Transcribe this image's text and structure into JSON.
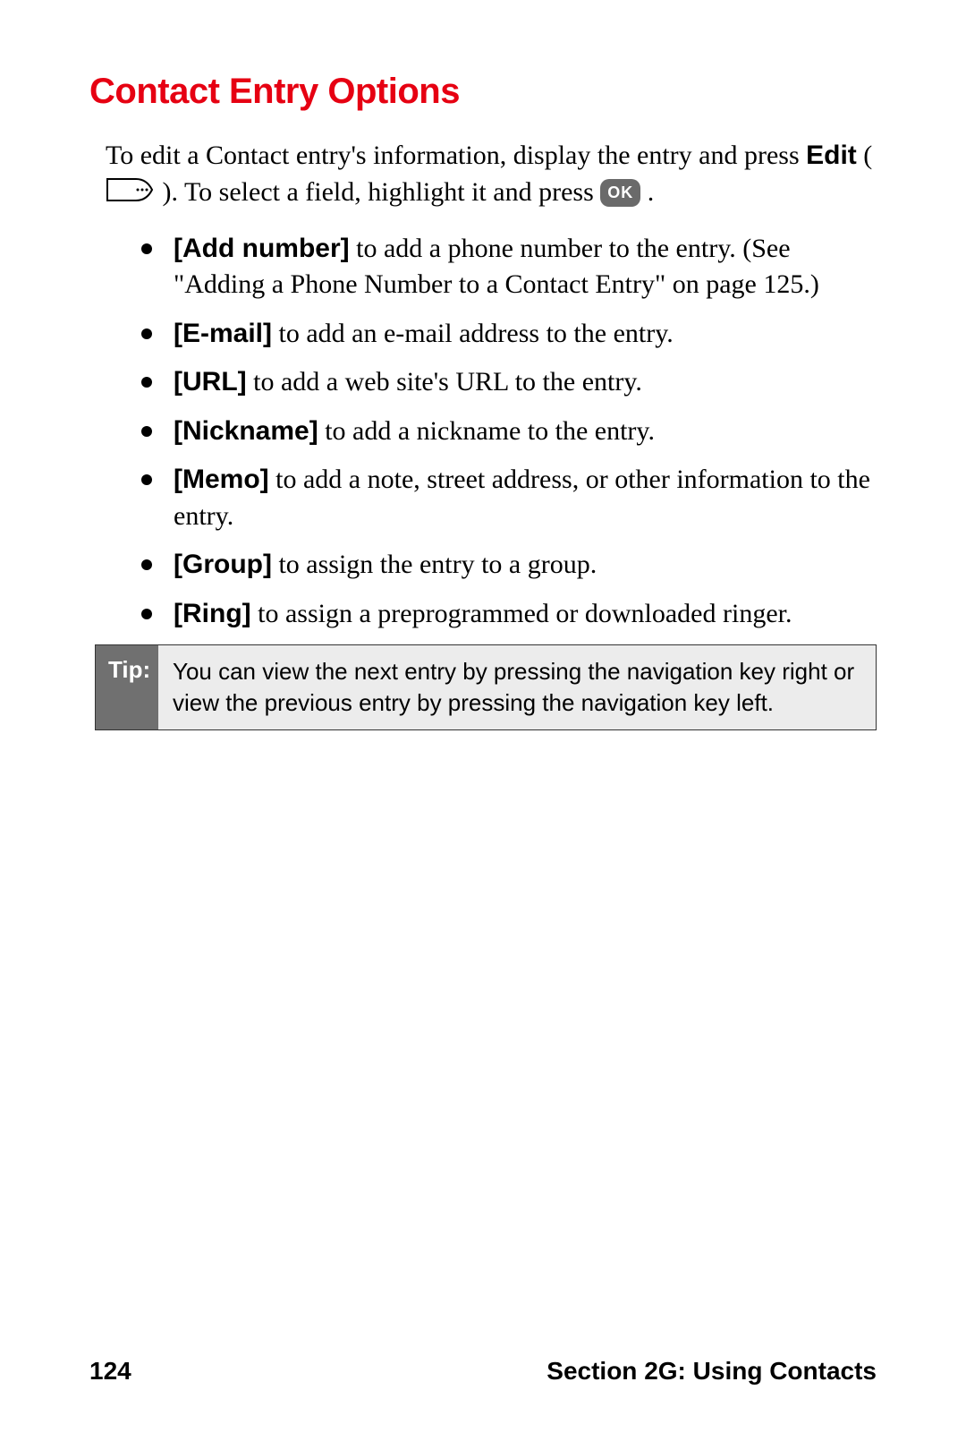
{
  "heading": "Contact Entry Options",
  "intro": {
    "part1": "To edit a Contact entry's information, display the entry and press ",
    "edit_label": "Edit",
    "part2_open": " (",
    "part2_close": "). To select a field, highlight it and press ",
    "ok_label": "OK",
    "period": "."
  },
  "options": [
    {
      "label": "[Add number]",
      "text": " to add a phone number to the entry. (See \"Adding a Phone Number to a Contact Entry\" on page 125.)"
    },
    {
      "label": "[E-mail]",
      "text": " to add an e-mail address to the entry."
    },
    {
      "label": "[URL]",
      "text": " to add a web site's URL to the entry."
    },
    {
      "label": "[Nickname]",
      "text": " to add a nickname to the entry."
    },
    {
      "label": "[Memo]",
      "text": " to add a note, street address, or other information to the entry."
    },
    {
      "label": "[Group]",
      "text": " to assign the entry to a group."
    },
    {
      "label": "[Ring]",
      "text": " to assign a preprogrammed or downloaded ringer."
    }
  ],
  "tip": {
    "label": "Tip:",
    "body": "You can view the next entry by pressing the navigation key right or view the previous entry by pressing the navigation key left."
  },
  "footer": {
    "page_number": "124",
    "section": "Section 2G: Using Contacts"
  }
}
